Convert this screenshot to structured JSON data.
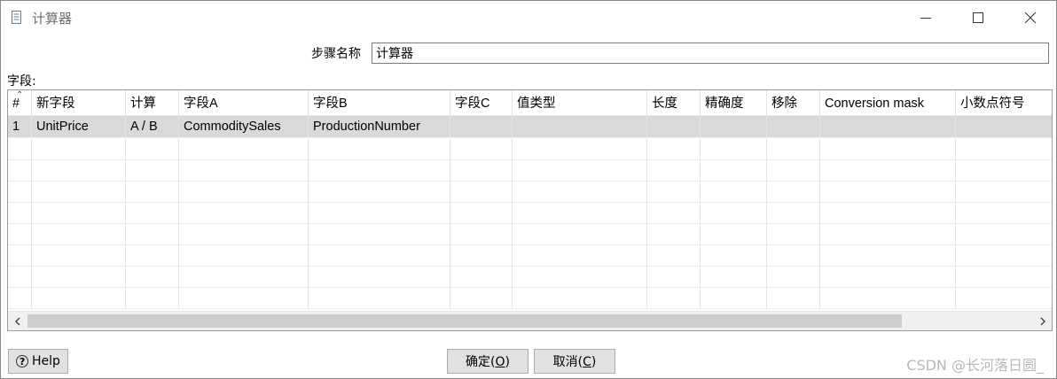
{
  "window": {
    "title": "计算器",
    "icon": "calculator-document-icon"
  },
  "form": {
    "step_name_label": "步骤名称",
    "step_name_value": "计算器",
    "fields_label": "字段:"
  },
  "table": {
    "columns": [
      "#",
      "新字段",
      "计算",
      "字段A",
      "字段B",
      "字段C",
      "值类型",
      "长度",
      "精确度",
      "移除",
      "Conversion mask",
      "小数点符号"
    ],
    "rows": [
      [
        "1",
        "UnitPrice",
        "A / B",
        "CommoditySales",
        "ProductionNumber",
        "",
        "",
        "",
        "",
        "",
        "",
        ""
      ]
    ],
    "selected_row": 0
  },
  "buttons": {
    "help_label": "Help",
    "ok_label": "确定(",
    "ok_key": "O",
    "ok_close": ")",
    "cancel_label": "取消(",
    "cancel_key": "C",
    "cancel_close": ")"
  },
  "watermark": "CSDN @长河落日圆_"
}
